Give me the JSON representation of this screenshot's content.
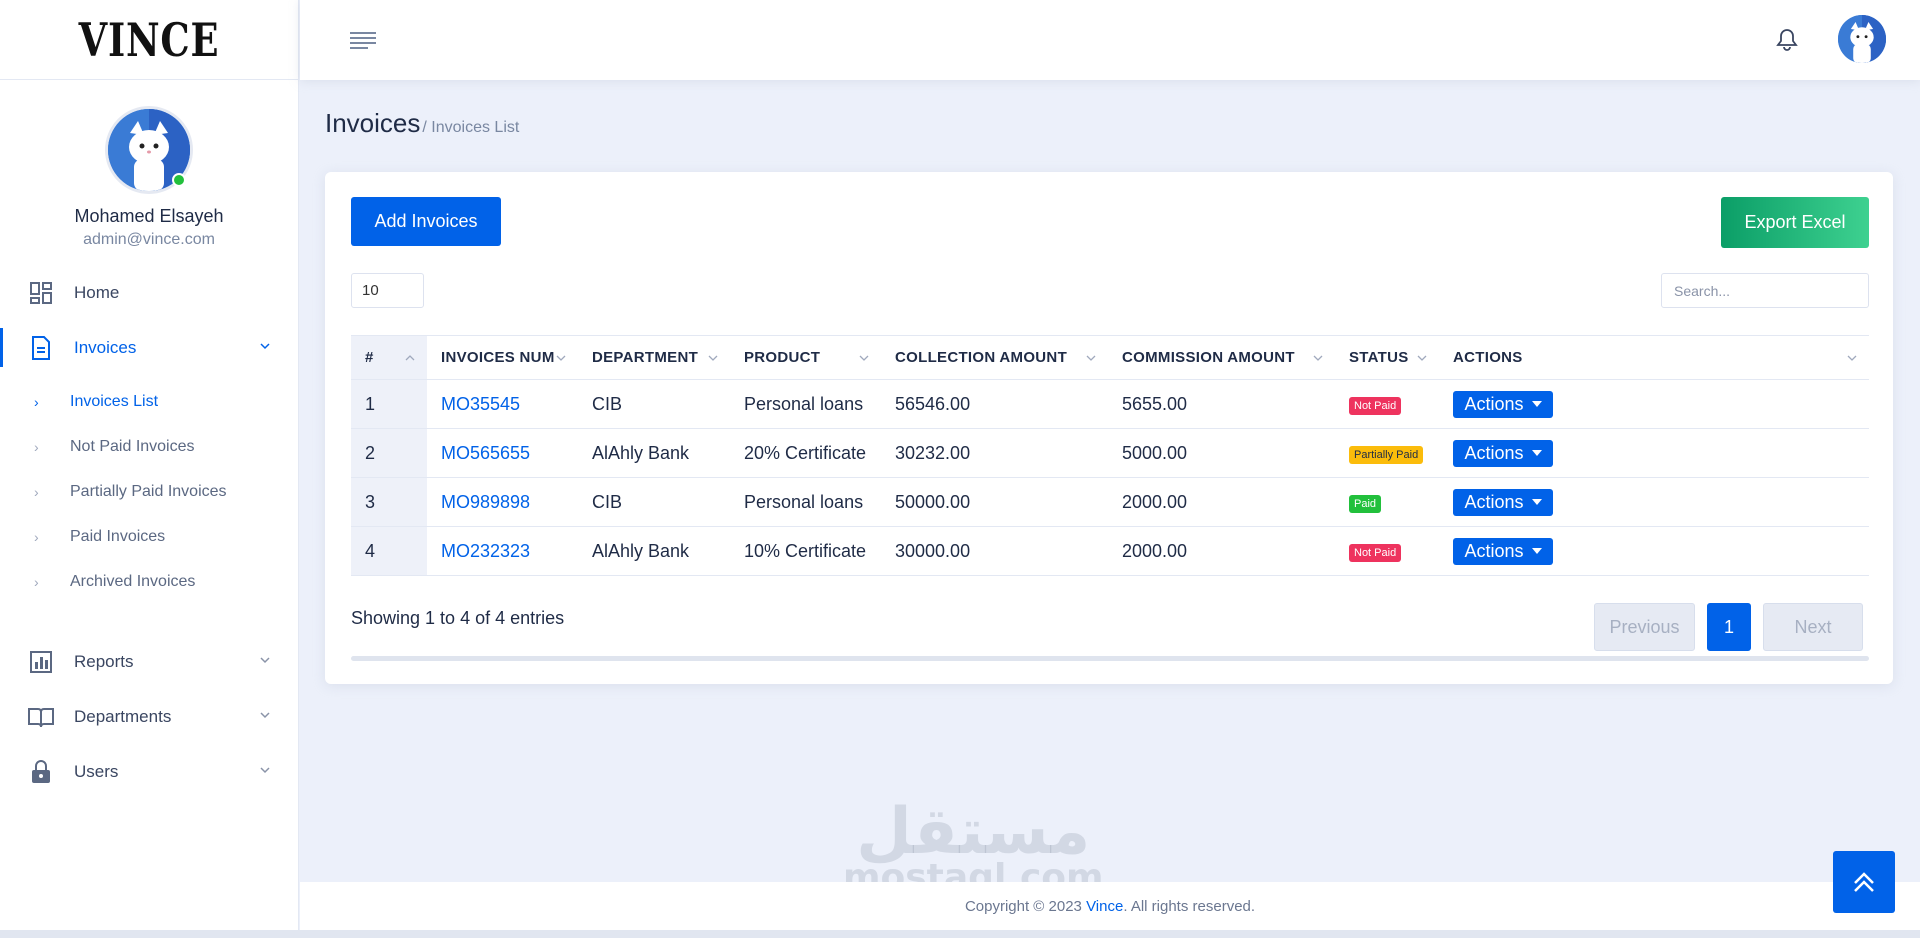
{
  "app": {
    "logo_text": "VINCE"
  },
  "profile": {
    "name": "Mohamed Elsayeh",
    "email": "admin@vince.com"
  },
  "sidebar": {
    "home": "Home",
    "invoices": "Invoices",
    "invoice_sub": [
      {
        "label": "Invoices List"
      },
      {
        "label": "Not Paid Invoices"
      },
      {
        "label": "Partially Paid Invoices"
      },
      {
        "label": "Paid Invoices"
      },
      {
        "label": "Archived Invoices"
      }
    ],
    "reports": "Reports",
    "departments": "Departments",
    "users": "Users"
  },
  "page": {
    "title": "Invoices",
    "breadcrumb": "/ Invoices List"
  },
  "toolbar": {
    "add_label": "Add Invoices",
    "export_label": "Export Excel",
    "page_length": "10",
    "search_placeholder": "Search..."
  },
  "table": {
    "headers": [
      "#",
      "INVOICES NUM",
      "DEPARTMENT",
      "PRODUCT",
      "COLLECTION AMOUNT",
      "COMMISSION AMOUNT",
      "STATUS",
      "ACTIONS"
    ],
    "rows": [
      {
        "num": "1",
        "invoice": "MO35545",
        "department": "CIB",
        "product": "Personal loans",
        "collection": "56546.00",
        "commission": "5655.00",
        "status": "Not Paid",
        "status_color": "#ee335e",
        "action": "Actions"
      },
      {
        "num": "2",
        "invoice": "MO565655",
        "department": "AlAhly Bank",
        "product": "20% Certificate",
        "collection": "30232.00",
        "commission": "5000.00",
        "status": "Partially Paid",
        "status_color": "#fbbc0b",
        "action": "Actions"
      },
      {
        "num": "3",
        "invoice": "MO989898",
        "department": "CIB",
        "product": "Personal loans",
        "collection": "50000.00",
        "commission": "2000.00",
        "status": "Paid",
        "status_color": "#22c03c",
        "action": "Actions"
      },
      {
        "num": "4",
        "invoice": "MO232323",
        "department": "AlAhly Bank",
        "product": "10% Certificate",
        "collection": "30000.00",
        "commission": "2000.00",
        "status": "Not Paid",
        "status_color": "#ee335e",
        "action": "Actions"
      }
    ]
  },
  "pagination": {
    "info": "Showing 1 to 4 of 4 entries",
    "previous": "Previous",
    "current": "1",
    "next": "Next"
  },
  "footer": {
    "prefix": "Copyright © 2023 ",
    "brand": "Vince",
    "suffix": ". All rights reserved."
  },
  "watermark": {
    "arabic": "مستقل",
    "latin": "mostaql.com"
  },
  "colors": {
    "primary": "#0162e8",
    "success": "#22c03c",
    "danger": "#ee335e",
    "warning": "#fbbc0b"
  }
}
